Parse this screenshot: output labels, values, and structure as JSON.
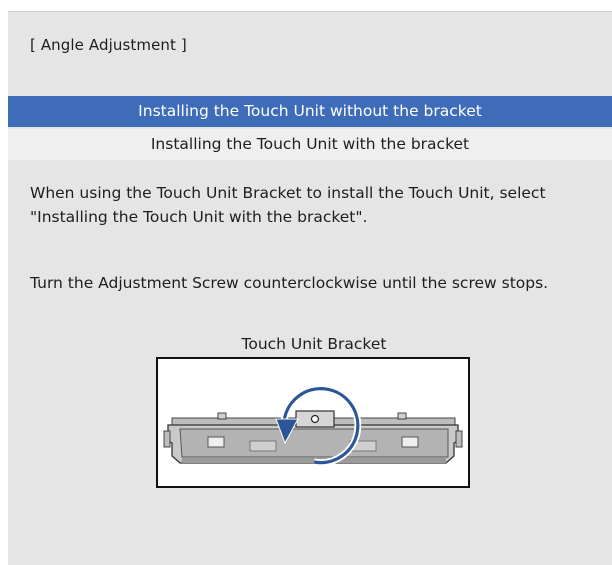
{
  "dialog": {
    "title": "[ Angle Adjustment ]"
  },
  "options": [
    {
      "label": "Installing the Touch Unit without the bracket",
      "selected": true
    },
    {
      "label": "Installing the Touch Unit with the bracket",
      "selected": false
    }
  ],
  "instructions": {
    "bracket_note": "When using the Touch Unit Bracket to install the Touch Unit, select \"Installing the Touch Unit with the bracket\".",
    "screw_note": "Turn the Adjustment Screw counterclockwise until the screw stops."
  },
  "figure": {
    "caption": "Touch Unit Bracket",
    "icons": [
      "bracket-illustration",
      "counterclockwise-arrow-icon"
    ]
  },
  "colors": {
    "background": "#e5e5e5",
    "selected_option": "#3f6cb9",
    "unselected_option": "#efefef",
    "arrow": "#2b579a"
  }
}
